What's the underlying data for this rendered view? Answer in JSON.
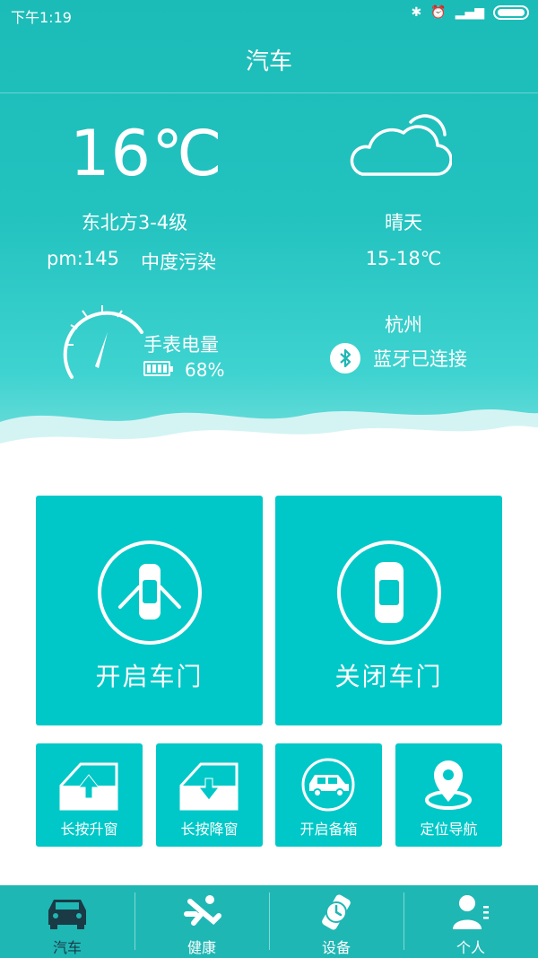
{
  "status": {
    "time": "下午1:19"
  },
  "header": {
    "title": "汽车"
  },
  "weather": {
    "temperature": "16℃",
    "wind": "东北方3-4级",
    "pm": "pm:145",
    "pollution": "中度污染",
    "condition": "晴天",
    "range": "15-18℃",
    "city": "杭州"
  },
  "watch": {
    "label": "手表电量",
    "battery": "68%"
  },
  "bluetooth": {
    "status": "蓝牙已连接"
  },
  "actions": {
    "open_door": "开启车门",
    "close_door": "关闭车门",
    "raise_window": "长按升窗",
    "lower_window": "长按降窗",
    "open_trunk": "开启备箱",
    "navigate": "定位导航"
  },
  "tabs": [
    {
      "label": "汽车",
      "icon": "car-icon",
      "active": true
    },
    {
      "label": "健康",
      "icon": "runner-icon",
      "active": false
    },
    {
      "label": "设备",
      "icon": "watch-icon",
      "active": false
    },
    {
      "label": "个人",
      "icon": "person-icon",
      "active": false
    }
  ],
  "colors": {
    "primary": "#00c8c8",
    "tabbar": "#1fb7b4",
    "active_tab": "#1a3a46"
  }
}
